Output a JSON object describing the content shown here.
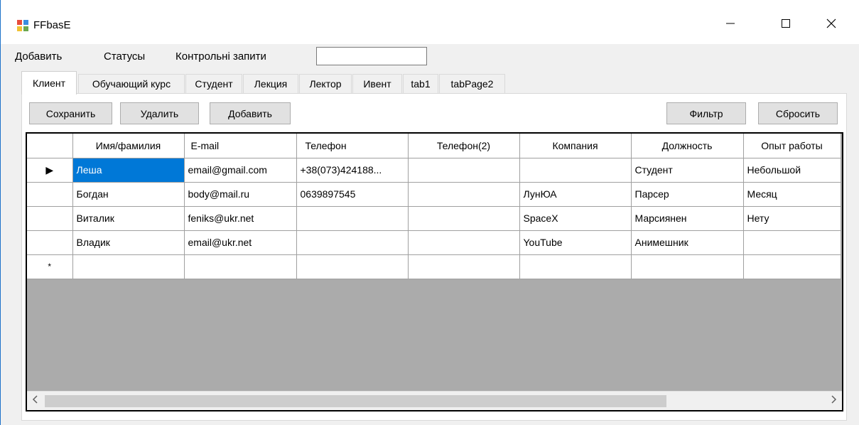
{
  "window": {
    "title": "FFbasE",
    "icon": "app-icon",
    "controls": [
      "minimize-icon",
      "maximize-icon",
      "close-icon"
    ]
  },
  "menu": {
    "items": [
      "Добавить",
      "Статусы",
      "Контрольні запити"
    ],
    "input_value": ""
  },
  "tabs": [
    "Клиент",
    "Обучающий курс",
    "Студент",
    "Лекция",
    "Лектор",
    "Ивент",
    "tab1",
    "tabPage2"
  ],
  "active_tab": "Клиент",
  "toolbar": {
    "save": "Сохранить",
    "delete": "Удалить",
    "add": "Добавить",
    "filter": "Фильтр",
    "reset": "Сбросить"
  },
  "grid": {
    "columns": [
      "Имя/фамилия",
      "E-mail",
      "Телефон",
      "Телефон(2)",
      "Компания",
      "Должность",
      "Опыт работы"
    ],
    "rows": [
      [
        "Леша",
        "email@gmail.com",
        "+38(073)424188...",
        "",
        "",
        "Студент",
        "Небольшой"
      ],
      [
        "Богдан",
        "body@mail.ru",
        "0639897545",
        "",
        "ЛунЮА",
        "Парсер",
        "Месяц"
      ],
      [
        "Виталик",
        "feniks@ukr.net",
        "",
        "",
        "SpaceX",
        "Марсиянен",
        "Нету"
      ],
      [
        "Владик",
        "email@ukr.net",
        "",
        "",
        "YouTube",
        "Анимешник",
        ""
      ]
    ],
    "current_row_marker": "▶",
    "new_row_marker": "*",
    "selection_color": "#0078d7"
  }
}
